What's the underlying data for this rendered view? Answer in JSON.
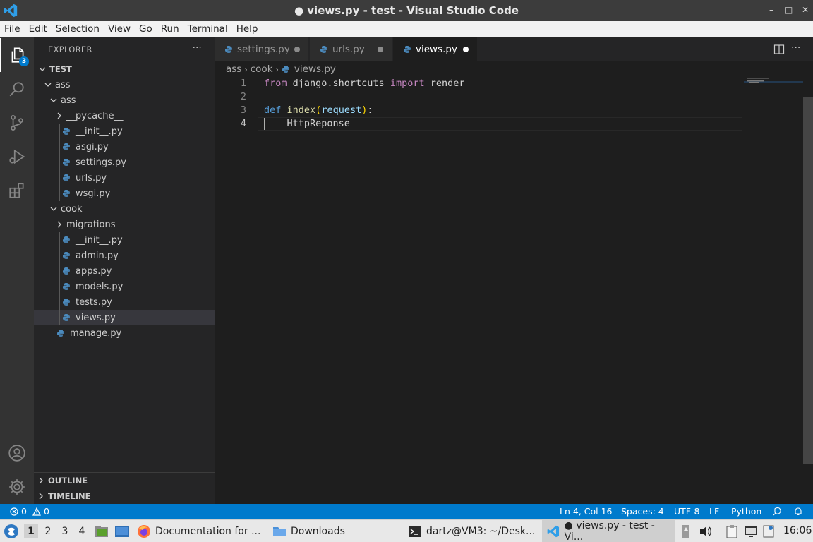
{
  "window": {
    "title": "● views.py - test - Visual Studio Code",
    "minimize": "–",
    "maximize": "□",
    "close": "✕"
  },
  "menu": [
    "File",
    "Edit",
    "Selection",
    "View",
    "Go",
    "Run",
    "Terminal",
    "Help"
  ],
  "activity": {
    "explorer_badge": "3"
  },
  "sidebar": {
    "header": "EXPLORER",
    "more": "···",
    "tree": [
      {
        "label": "TEST",
        "type": "section",
        "depth": 0,
        "expanded": true
      },
      {
        "label": "ass",
        "type": "folder",
        "depth": 1,
        "expanded": true
      },
      {
        "label": "ass",
        "type": "folder",
        "depth": 2,
        "expanded": true
      },
      {
        "label": "__pycache__",
        "type": "folder",
        "depth": 3,
        "expanded": false
      },
      {
        "label": "__init__.py",
        "type": "file",
        "depth": 3
      },
      {
        "label": "asgi.py",
        "type": "file",
        "depth": 3
      },
      {
        "label": "settings.py",
        "type": "file",
        "depth": 3
      },
      {
        "label": "urls.py",
        "type": "file",
        "depth": 3
      },
      {
        "label": "wsgi.py",
        "type": "file",
        "depth": 3
      },
      {
        "label": "cook",
        "type": "folder",
        "depth": 2,
        "expanded": true
      },
      {
        "label": "migrations",
        "type": "folder",
        "depth": 3,
        "expanded": false
      },
      {
        "label": "__init__.py",
        "type": "file",
        "depth": 3
      },
      {
        "label": "admin.py",
        "type": "file",
        "depth": 3
      },
      {
        "label": "apps.py",
        "type": "file",
        "depth": 3
      },
      {
        "label": "models.py",
        "type": "file",
        "depth": 3
      },
      {
        "label": "tests.py",
        "type": "file",
        "depth": 3
      },
      {
        "label": "views.py",
        "type": "file",
        "depth": 3,
        "selected": true
      },
      {
        "label": "manage.py",
        "type": "file",
        "depth": 2
      }
    ],
    "outline": "OUTLINE",
    "timeline": "TIMELINE"
  },
  "tabs": [
    {
      "label": "settings.py",
      "active": false,
      "modified": true
    },
    {
      "label": "urls.py",
      "active": false,
      "modified": true
    },
    {
      "label": "views.py",
      "active": true,
      "modified": true
    }
  ],
  "breadcrumb": {
    "part1": "ass",
    "part2": "cook",
    "file": "views.py"
  },
  "editor": {
    "line_numbers": [
      "1",
      "2",
      "3",
      "4"
    ],
    "line1": {
      "kw1": "from",
      "mod": " django.shortcuts ",
      "kw2": "import",
      "name": " render"
    },
    "line3": {
      "kw": "def",
      "sp": " ",
      "fn": "index",
      "open": "(",
      "param": "request",
      "close": ")",
      "colon": ":"
    },
    "line4": {
      "text": "    HttpReponse"
    }
  },
  "status": {
    "errors": "0",
    "warnings": "0",
    "position": "Ln 4, Col 16",
    "spaces": "Spaces: 4",
    "encoding": "UTF-8",
    "eol": "LF",
    "language": "Python"
  },
  "taskbar": {
    "workspaces": [
      "1",
      "2",
      "3",
      "4"
    ],
    "apps": [
      {
        "label": "Documentation for ..."
      },
      {
        "label": "Downloads"
      },
      {
        "label": "dartz@VM3: ~/Desk..."
      },
      {
        "label": "● views.py - test - Vi..."
      }
    ],
    "clock": "16:06"
  },
  "colors": {
    "accent": "#007acc",
    "sidebar": "#252526",
    "editor": "#1e1e1e",
    "activitybar": "#333333",
    "titlebar": "#3c3c3c"
  }
}
